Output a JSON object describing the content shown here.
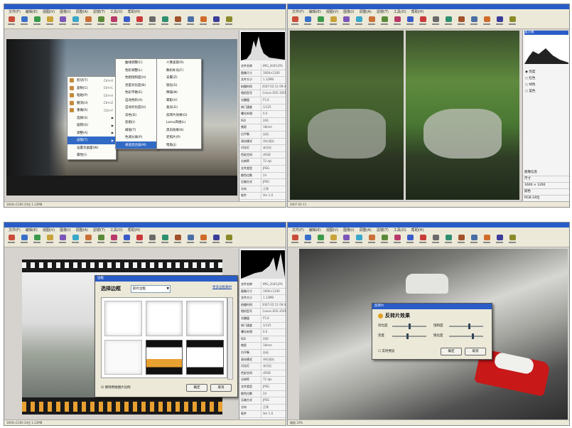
{
  "menubar": [
    "文件(F)",
    "编辑(E)",
    "视图(V)",
    "图像(I)",
    "调整(A)",
    "滤镜(T)",
    "工具(O)",
    "帮助(H)"
  ],
  "toolbar_colors": [
    "#c94d3a",
    "#3a6fc9",
    "#3b9a4c",
    "#c9a23a",
    "#7d56b8",
    "#3aa8c9",
    "#c9703a",
    "#5b8a3a",
    "#b83a6a",
    "#3a5bc9",
    "#c93a3a",
    "#6a6a6a",
    "#2f8f6f",
    "#a0522d",
    "#4a6fa5",
    "#d06b2b",
    "#3c3c9a",
    "#8a8a2a"
  ],
  "properties": {
    "keys": [
      "文件名称",
      "图像尺寸",
      "文件大小",
      "拍摄时间",
      "相机型号",
      "光圈值",
      "快门速度",
      "曝光补偿",
      "ISO",
      "焦距",
      "白平衡",
      "测光模式",
      "闪光灯",
      "色彩空间",
      "分辨率",
      "文件类型",
      "颜色位数",
      "压缩方式",
      "方向",
      "软件"
    ],
    "values": [
      "IMG_2045.JPG",
      "1600×1200",
      "1.12MB",
      "2007:02:11 09:41",
      "Canon EOS 350D",
      "F5.6",
      "1/125",
      "0.0",
      "200",
      "18mm",
      "自动",
      "评价测光",
      "未闪光",
      "sRGB",
      "72 dpi",
      "JPEG",
      "24",
      "JPEG",
      "正常",
      "Ver 1.0"
    ]
  },
  "context_menu": {
    "items": [
      {
        "label": "剪切(T)",
        "shortcut": "Ctrl+X"
      },
      {
        "label": "复制(C)",
        "shortcut": "Ctrl+C"
      },
      {
        "label": "粘贴(P)",
        "shortcut": "Ctrl+V"
      },
      {
        "label": "撤消(U)",
        "shortcut": "Ctrl+Z"
      },
      {
        "label": "重做(R)",
        "shortcut": "Ctrl+Y"
      },
      {
        "label": "选择(S)",
        "shortcut": ""
      },
      {
        "label": "旋转(O)",
        "shortcut": ""
      },
      {
        "label": "调整(A)",
        "shortcut": ""
      },
      {
        "label": "滤镜(T)",
        "shortcut": ""
      },
      {
        "label": "设置为桌面(W)",
        "shortcut": ""
      },
      {
        "label": "属性(I)",
        "shortcut": ""
      }
    ],
    "submenu1": [
      "曲线调整(C)",
      "色阶调整(L)",
      "色相饱和度(H)",
      "亮度对比度(B)",
      "色彩平衡(E)",
      "自动色阶(A)",
      "自动对比度(U)",
      "去色(D)",
      "反相(I)",
      "阈值(T)",
      "色调分离(P)",
      "通道混合器(M)",
      "黑白(K)",
      "夜景(N)",
      "模糊(Z)",
      "艺术效果(F)"
    ],
    "submenu2": [
      "人像美容(R)",
      "数码补光(F)",
      "去雾(Z)",
      "锐化(S)",
      "降噪(N)",
      "晕影(V)",
      "柔光(G)",
      "反转片效果(O)",
      "Lomo风格(L)",
      "黑白效果(K)",
      "老照片(P)",
      "暗角(J)"
    ]
  },
  "histogram_panel": {
    "title": "直方图",
    "options": [
      "亮度",
      "红色",
      "绿色",
      "蓝色"
    ],
    "info_rows": [
      "图像信息",
      "尺寸",
      "1600 × 1200",
      "颜色",
      "RGB 24位"
    ]
  },
  "border_dialog": {
    "title": "边框",
    "heading": "选择边框",
    "select_value": "胶片边框",
    "link": "更多边框素材",
    "checkbox_label": "保持原始图片比例",
    "ok": "确定",
    "cancel": "取消"
  },
  "film_dialog": {
    "title": "反转片",
    "heading": "反转片效果",
    "labels": [
      "对比度",
      "饱和度",
      "亮度",
      "锐化度"
    ],
    "values": [
      50,
      60,
      45,
      70
    ],
    "checkbox_label": "实时预览",
    "ok": "确定",
    "cancel": "取消"
  },
  "status_text": [
    "1600×1200  24位  1.12MB",
    "2007-02-11",
    "缩放 33%"
  ]
}
